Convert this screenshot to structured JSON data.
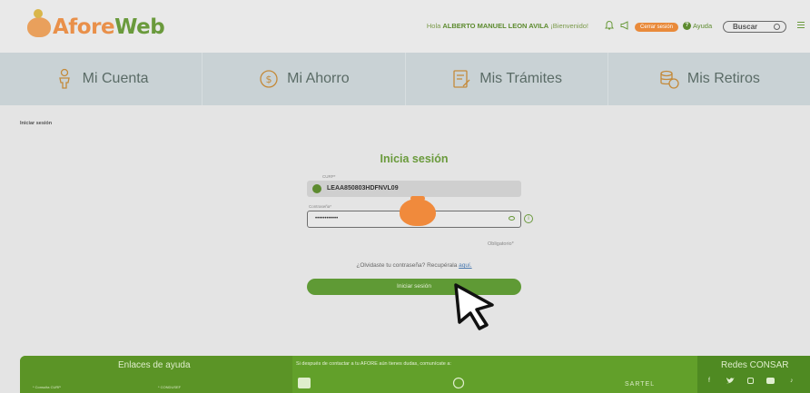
{
  "header": {
    "logo_text_a": "Afore",
    "logo_text_b": "Web",
    "greeting_prefix": "Hola",
    "user_name": "ALBERTO MANUEL LEON AVILA",
    "greeting_suffix": "¡Bienvenido!",
    "logout_label": "Cerrar sesión",
    "help_label": "Ayuda",
    "search_label": "Buscar"
  },
  "nav": {
    "items": [
      {
        "label": "Mi Cuenta",
        "icon": "person-icon"
      },
      {
        "label": "Mi Ahorro",
        "icon": "money-icon"
      },
      {
        "label": "Mis Trámites",
        "icon": "document-icon"
      },
      {
        "label": "Mis Retiros",
        "icon": "coins-icon"
      }
    ]
  },
  "breadcrumb": "Iniciar sesión",
  "login": {
    "title": "Inicia sesión",
    "curp_label": "CURP*",
    "curp_value": "LEAA850803HDFNVL09",
    "password_label": "Contraseña*",
    "password_value": "••••••••••••",
    "required_note": "Obligatorio*",
    "forgot_text": "¿Olvidaste tu contraseña? Recupérala",
    "forgot_link": "aquí.",
    "submit_label": "Iniciar sesión"
  },
  "footer": {
    "help_links_title": "Enlaces de ayuda",
    "link_1": "* Consulta CURP",
    "link_2": "* CONDUSEF",
    "contact_note": "Si después de contactar a tu AFORE aún tienes dudas, comunícate a:",
    "sartel": "SARTEL",
    "social_title": "Redes CONSAR"
  },
  "colors": {
    "brand_green": "#6a9a3c",
    "brand_orange": "#e98a3a",
    "nav_bg": "#c9d2d5",
    "footer_green": "#62a02a"
  }
}
